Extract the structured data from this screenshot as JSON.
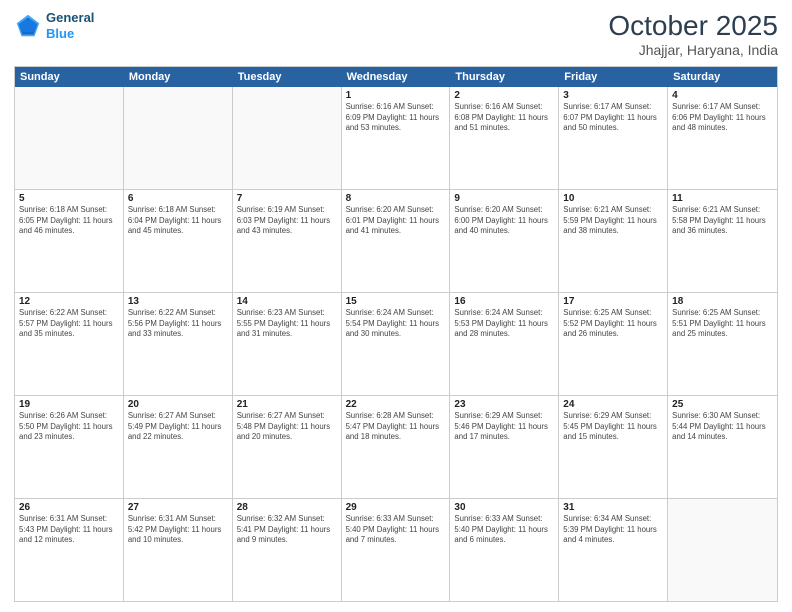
{
  "header": {
    "logo_line1": "General",
    "logo_line2": "Blue",
    "month": "October 2025",
    "location": "Jhajjar, Haryana, India"
  },
  "days_of_week": [
    "Sunday",
    "Monday",
    "Tuesday",
    "Wednesday",
    "Thursday",
    "Friday",
    "Saturday"
  ],
  "weeks": [
    [
      {
        "date": "",
        "info": ""
      },
      {
        "date": "",
        "info": ""
      },
      {
        "date": "",
        "info": ""
      },
      {
        "date": "1",
        "info": "Sunrise: 6:16 AM\nSunset: 6:09 PM\nDaylight: 11 hours and 53 minutes."
      },
      {
        "date": "2",
        "info": "Sunrise: 6:16 AM\nSunset: 6:08 PM\nDaylight: 11 hours and 51 minutes."
      },
      {
        "date": "3",
        "info": "Sunrise: 6:17 AM\nSunset: 6:07 PM\nDaylight: 11 hours and 50 minutes."
      },
      {
        "date": "4",
        "info": "Sunrise: 6:17 AM\nSunset: 6:06 PM\nDaylight: 11 hours and 48 minutes."
      }
    ],
    [
      {
        "date": "5",
        "info": "Sunrise: 6:18 AM\nSunset: 6:05 PM\nDaylight: 11 hours and 46 minutes."
      },
      {
        "date": "6",
        "info": "Sunrise: 6:18 AM\nSunset: 6:04 PM\nDaylight: 11 hours and 45 minutes."
      },
      {
        "date": "7",
        "info": "Sunrise: 6:19 AM\nSunset: 6:03 PM\nDaylight: 11 hours and 43 minutes."
      },
      {
        "date": "8",
        "info": "Sunrise: 6:20 AM\nSunset: 6:01 PM\nDaylight: 11 hours and 41 minutes."
      },
      {
        "date": "9",
        "info": "Sunrise: 6:20 AM\nSunset: 6:00 PM\nDaylight: 11 hours and 40 minutes."
      },
      {
        "date": "10",
        "info": "Sunrise: 6:21 AM\nSunset: 5:59 PM\nDaylight: 11 hours and 38 minutes."
      },
      {
        "date": "11",
        "info": "Sunrise: 6:21 AM\nSunset: 5:58 PM\nDaylight: 11 hours and 36 minutes."
      }
    ],
    [
      {
        "date": "12",
        "info": "Sunrise: 6:22 AM\nSunset: 5:57 PM\nDaylight: 11 hours and 35 minutes."
      },
      {
        "date": "13",
        "info": "Sunrise: 6:22 AM\nSunset: 5:56 PM\nDaylight: 11 hours and 33 minutes."
      },
      {
        "date": "14",
        "info": "Sunrise: 6:23 AM\nSunset: 5:55 PM\nDaylight: 11 hours and 31 minutes."
      },
      {
        "date": "15",
        "info": "Sunrise: 6:24 AM\nSunset: 5:54 PM\nDaylight: 11 hours and 30 minutes."
      },
      {
        "date": "16",
        "info": "Sunrise: 6:24 AM\nSunset: 5:53 PM\nDaylight: 11 hours and 28 minutes."
      },
      {
        "date": "17",
        "info": "Sunrise: 6:25 AM\nSunset: 5:52 PM\nDaylight: 11 hours and 26 minutes."
      },
      {
        "date": "18",
        "info": "Sunrise: 6:25 AM\nSunset: 5:51 PM\nDaylight: 11 hours and 25 minutes."
      }
    ],
    [
      {
        "date": "19",
        "info": "Sunrise: 6:26 AM\nSunset: 5:50 PM\nDaylight: 11 hours and 23 minutes."
      },
      {
        "date": "20",
        "info": "Sunrise: 6:27 AM\nSunset: 5:49 PM\nDaylight: 11 hours and 22 minutes."
      },
      {
        "date": "21",
        "info": "Sunrise: 6:27 AM\nSunset: 5:48 PM\nDaylight: 11 hours and 20 minutes."
      },
      {
        "date": "22",
        "info": "Sunrise: 6:28 AM\nSunset: 5:47 PM\nDaylight: 11 hours and 18 minutes."
      },
      {
        "date": "23",
        "info": "Sunrise: 6:29 AM\nSunset: 5:46 PM\nDaylight: 11 hours and 17 minutes."
      },
      {
        "date": "24",
        "info": "Sunrise: 6:29 AM\nSunset: 5:45 PM\nDaylight: 11 hours and 15 minutes."
      },
      {
        "date": "25",
        "info": "Sunrise: 6:30 AM\nSunset: 5:44 PM\nDaylight: 11 hours and 14 minutes."
      }
    ],
    [
      {
        "date": "26",
        "info": "Sunrise: 6:31 AM\nSunset: 5:43 PM\nDaylight: 11 hours and 12 minutes."
      },
      {
        "date": "27",
        "info": "Sunrise: 6:31 AM\nSunset: 5:42 PM\nDaylight: 11 hours and 10 minutes."
      },
      {
        "date": "28",
        "info": "Sunrise: 6:32 AM\nSunset: 5:41 PM\nDaylight: 11 hours and 9 minutes."
      },
      {
        "date": "29",
        "info": "Sunrise: 6:33 AM\nSunset: 5:40 PM\nDaylight: 11 hours and 7 minutes."
      },
      {
        "date": "30",
        "info": "Sunrise: 6:33 AM\nSunset: 5:40 PM\nDaylight: 11 hours and 6 minutes."
      },
      {
        "date": "31",
        "info": "Sunrise: 6:34 AM\nSunset: 5:39 PM\nDaylight: 11 hours and 4 minutes."
      },
      {
        "date": "",
        "info": ""
      }
    ]
  ]
}
